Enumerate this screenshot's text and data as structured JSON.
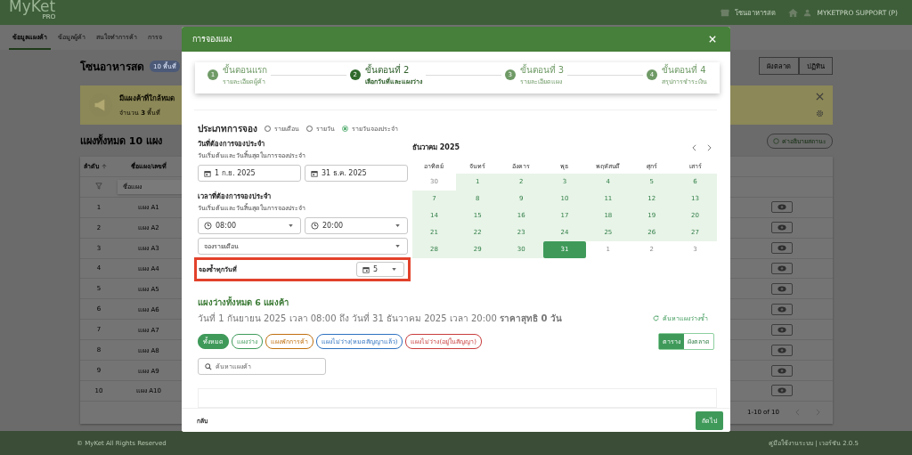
{
  "header": {
    "logo": "MyKet",
    "logo_sub": "PRO",
    "zone": "โซนอาหารสด",
    "user": "MYKETPRO SUPPORT (P)"
  },
  "nav_tabs": [
    {
      "label": "ข้อมูลแผงค้า",
      "selected": true
    },
    {
      "label": "ข้อมูลผู้ค้า",
      "selected": false
    },
    {
      "label": "สนใจทำการค้า",
      "selected": false
    },
    {
      "label": "การจ",
      "selected": false
    }
  ],
  "page": {
    "title": "โซนอาหารสด",
    "badge": "10 พื้นที่",
    "buttons": [
      "ผังตลาด",
      "ปฏิทิน"
    ]
  },
  "alert": {
    "title": "มีแผงค้าที่ใกล้หมด",
    "text": "จำนวน **3** พื้นที่"
  },
  "stalls": {
    "title": "แผงทั้งหมด 10 แผง",
    "legend_button": "ค่าอธิบายสถานะ",
    "columns": [
      "ลำดับ",
      "ชื่อแผง/เลขที่"
    ],
    "filter_placeholder": "ชื่อแผง",
    "pagination": "1-10 of 10",
    "rows": [
      {
        "index": "1",
        "name": "แผง A1"
      },
      {
        "index": "2",
        "name": "แผง A2"
      },
      {
        "index": "3",
        "name": "แผง A3"
      },
      {
        "index": "4",
        "name": "แผง A4"
      },
      {
        "index": "5",
        "name": "แผง A5"
      },
      {
        "index": "6",
        "name": "แผง A6"
      },
      {
        "index": "7",
        "name": "แผง A7"
      },
      {
        "index": "8",
        "name": "แผง A8"
      },
      {
        "index": "9",
        "name": "แผง A9"
      },
      {
        "index": "10",
        "name": "แผง A10"
      }
    ]
  },
  "footer": {
    "copyright": "© MyKet All Rights Reserved",
    "info": "คู่มือใช้งานระบบ | เวอร์ชัน 2.0.5"
  },
  "modal": {
    "title": "การจองแผง",
    "steps": [
      {
        "number": "1",
        "title": "ขั้นตอนแรก",
        "subtitle": "รายละเอียดผู้ค้า",
        "selected": false
      },
      {
        "number": "2",
        "title": "ขั้นตอนที่ 2",
        "subtitle": "เลือกวันที่และแผงว่าง",
        "selected": true
      },
      {
        "number": "3",
        "title": "ขั้นตอนที่ 3",
        "subtitle": "รายละเอียดแผง",
        "selected": false
      },
      {
        "number": "4",
        "title": "ขั้นตอนที่ 4",
        "subtitle": "สรุปการชำระเงิน",
        "selected": false
      }
    ],
    "booking_type": {
      "label": "ประเภทการจอง",
      "options": [
        {
          "label": "รายเดือน",
          "selected": false
        },
        {
          "label": "รายวัน",
          "selected": false
        },
        {
          "label": "รายวันจองประจำ",
          "selected": true
        }
      ]
    },
    "date_section": {
      "title": "วันที่ต้องการจองประจำ",
      "hint": "วันเริ่มต้นและวันสิ้นสุดในการจองประจำ",
      "start": "1 ก.ย. 2025",
      "end": "31 ธ.ค. 2025"
    },
    "time_section": {
      "title": "เวลาที่ต้องการจองประจำ",
      "hint": "วันเริ่มต้นและวันสิ้นสุดในการจองประจำ",
      "start": "08:00",
      "end": "20:00"
    },
    "plan_select": "จองรายเดือน",
    "repeat": {
      "label": "จองซ้ำทุกวันที่",
      "value": "5",
      "highlighted": true
    },
    "calendar": {
      "month": "ธันวาคม 2025",
      "weekdays": [
        "อาทิตย์",
        "จันทร์",
        "อังคาร",
        "พุธ",
        "พฤหัสบดี",
        "ศุกร์",
        "เสาร์"
      ],
      "days": [
        {
          "day": "30",
          "in_range": false,
          "selected": false
        },
        {
          "day": "1",
          "in_range": true,
          "selected": false
        },
        {
          "day": "2",
          "in_range": true,
          "selected": false
        },
        {
          "day": "3",
          "in_range": true,
          "selected": false
        },
        {
          "day": "4",
          "in_range": true,
          "selected": false
        },
        {
          "day": "5",
          "in_range": true,
          "selected": false
        },
        {
          "day": "6",
          "in_range": true,
          "selected": false
        },
        {
          "day": "7",
          "in_range": true,
          "selected": false
        },
        {
          "day": "8",
          "in_range": true,
          "selected": false
        },
        {
          "day": "9",
          "in_range": true,
          "selected": false
        },
        {
          "day": "10",
          "in_range": true,
          "selected": false
        },
        {
          "day": "11",
          "in_range": true,
          "selected": false
        },
        {
          "day": "12",
          "in_range": true,
          "selected": false
        },
        {
          "day": "13",
          "in_range": true,
          "selected": false
        },
        {
          "day": "14",
          "in_range": true,
          "selected": false
        },
        {
          "day": "15",
          "in_range": true,
          "selected": false
        },
        {
          "day": "16",
          "in_range": true,
          "selected": false
        },
        {
          "day": "17",
          "in_range": true,
          "selected": false
        },
        {
          "day": "18",
          "in_range": true,
          "selected": false
        },
        {
          "day": "19",
          "in_range": true,
          "selected": false
        },
        {
          "day": "20",
          "in_range": true,
          "selected": false
        },
        {
          "day": "21",
          "in_range": true,
          "selected": false
        },
        {
          "day": "22",
          "in_range": true,
          "selected": false
        },
        {
          "day": "23",
          "in_range": true,
          "selected": false
        },
        {
          "day": "24",
          "in_range": true,
          "selected": false
        },
        {
          "day": "25",
          "in_range": true,
          "selected": false
        },
        {
          "day": "26",
          "in_range": true,
          "selected": false
        },
        {
          "day": "27",
          "in_range": true,
          "selected": false
        },
        {
          "day": "28",
          "in_range": true,
          "selected": false
        },
        {
          "day": "29",
          "in_range": true,
          "selected": false
        },
        {
          "day": "30",
          "in_range": true,
          "selected": false
        },
        {
          "day": "31",
          "in_range": true,
          "selected": true
        },
        {
          "day": "1",
          "in_range": false,
          "selected": false
        },
        {
          "day": "2",
          "in_range": false,
          "selected": false
        },
        {
          "day": "3",
          "in_range": false,
          "selected": false
        }
      ]
    },
    "results": {
      "title": "แผงว่างทั้งหมด 6 แผงค้า",
      "summary": "วันที่ 1 กันยายน 2025 เวลา 08:00 ถึง วันที่ 31 ธันวาคม 2025 เวลา 20:00 **ราคาสุทธิ 0 วัน**",
      "refresh": "ค้นหาแผงว่างซ้ำ",
      "filters": [
        {
          "label": "ทั้งหมด",
          "color": "#3f9a5a",
          "selected": true
        },
        {
          "label": "แผงว่าง",
          "color": "#3f9a5a",
          "selected": false
        },
        {
          "label": "แผงพักการค้า",
          "color": "#c07010",
          "selected": false
        },
        {
          "label": "แผงไม่ว่าง(หมดสัญญาแล้ว)",
          "color": "#2f72c0",
          "selected": false
        },
        {
          "label": "แผงไม่ว่าง(อยู่ในสัญญา)",
          "color": "#c83c3c",
          "selected": false
        }
      ],
      "views": [
        {
          "label": "ตาราง",
          "selected": true
        },
        {
          "label": "ผังตลาด",
          "selected": false
        }
      ],
      "search_placeholder": "ค้นหาแผงค้า"
    },
    "back": "กลับ",
    "next": "ถัดไป"
  }
}
